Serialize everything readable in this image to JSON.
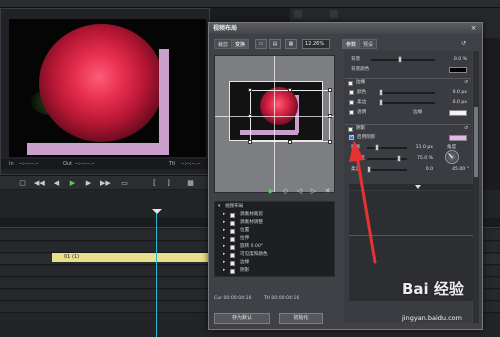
{
  "background": {
    "timecode_in_label": "In",
    "timecode_out_label": "Out",
    "timecode_ttl_label": "Ttl",
    "in_value": "--:--:--.--",
    "out_value": "--:--:--.--",
    "ttl_value": "--:--:--.--",
    "right_tab_1": "",
    "right_tab_2": "",
    "clip_label": "01 (1)"
  },
  "dialog": {
    "title": "视频布局",
    "close_glyph": "×",
    "left_tabs": [
      "裁剪",
      "变换"
    ],
    "zoom_value": "12.26%",
    "right_tabs": [
      "参数",
      "预设"
    ],
    "tree": [
      {
        "label": "视频布局",
        "root": true
      },
      {
        "label": "源素材裁剪"
      },
      {
        "label": "源素材调整"
      },
      {
        "label": "位置"
      },
      {
        "label": "拉伸"
      },
      {
        "label": "旋转 0.00°"
      },
      {
        "label": "可见度和颜色"
      },
      {
        "label": "边缘"
      },
      {
        "label": "阴影"
      }
    ],
    "timecode_cur": "Cur 00:00:04:16",
    "timecode_ttl": "Ttl 00:00:04:16",
    "save_default_button": "存为默认",
    "init_button": "初始化",
    "params": {
      "bg_label": "背景",
      "bg_value": "0.0 %",
      "bg_color_label": "背景颜色",
      "edge_section": "边缘",
      "color_label": "颜色",
      "color_value": "0.0 px",
      "soft_label": "柔边",
      "soft_value": "0.0 px",
      "transparent_label": "透明",
      "border_label": "边缘",
      "shadow_section": "阴影",
      "enable_shadow_label": "启用阴影",
      "distance_label": "距离",
      "distance_value": "11.0 px",
      "angle_label": "角度",
      "visible_label": "可见度",
      "visible_value": "75.0 %",
      "softness_label": "柔边",
      "softness_value": "0.0",
      "angle_value": "45.00 °"
    },
    "colors": {
      "shadow_swatch": "#e4b7e6",
      "bg_swatch": "#000000",
      "edge_swatch": "#f4f4f4"
    }
  },
  "watermark": {
    "text": "Bai 经验",
    "url": "jingyan.baidu.com"
  }
}
